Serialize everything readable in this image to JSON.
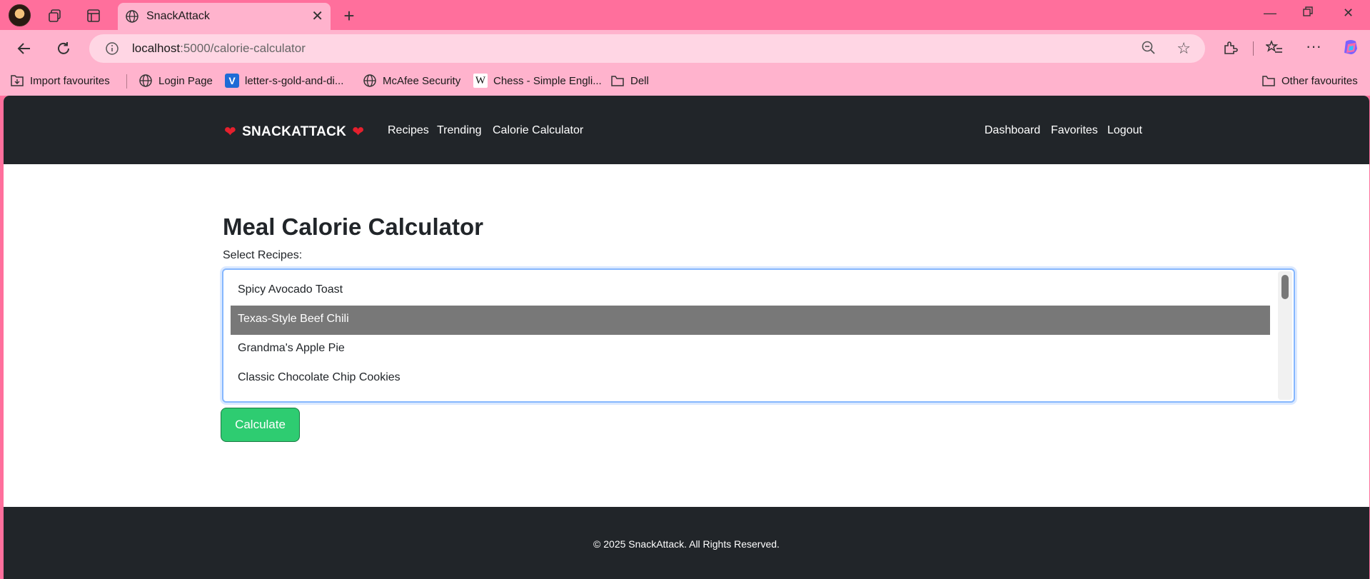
{
  "browser": {
    "tab_title": "SnackAttack",
    "address": {
      "host": "localhost",
      "path": ":5000/calorie-calculator"
    },
    "bookmarks": [
      {
        "label": "Import favourites",
        "icon": "import-icon"
      },
      {
        "label": "Login Page",
        "icon": "globe-icon"
      },
      {
        "label": "letter-s-gold-and-di...",
        "icon": "v-logo-icon"
      },
      {
        "label": "McAfee Security",
        "icon": "globe-icon"
      },
      {
        "label": "Chess - Simple Engli...",
        "icon": "wikipedia-icon"
      },
      {
        "label": "Dell",
        "icon": "folder-icon"
      }
    ],
    "other_favourites": "Other favourites"
  },
  "site": {
    "brand": "SNACKATTACK",
    "nav_left": [
      "Recipes",
      "Trending",
      "Calorie Calculator"
    ],
    "nav_right": [
      "Dashboard",
      "Favorites",
      "Logout"
    ]
  },
  "main": {
    "title": "Meal Calorie Calculator",
    "select_label": "Select Recipes:",
    "options": [
      "Spicy Avocado Toast",
      "Texas-Style Beef Chili",
      "Grandma's Apple Pie",
      "Classic Chocolate Chip Cookies"
    ],
    "selected_option": "Texas-Style Beef Chili",
    "button_label": "Calculate"
  },
  "footer": {
    "text": "© 2025 SnackAttack. All Rights Reserved."
  },
  "colors": {
    "browser_frame": "#ff6f9c",
    "toolbar": "#ffb3cd",
    "navbar": "#212529",
    "button": "#2ecc71",
    "selected": "#787878",
    "heart": "#e5202d"
  }
}
